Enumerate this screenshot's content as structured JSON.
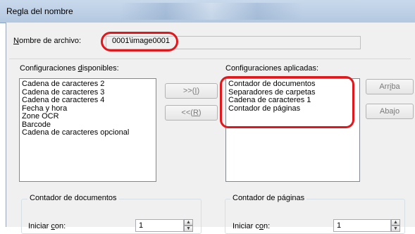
{
  "window": {
    "title": "Regla del nombre"
  },
  "filename": {
    "label_prefix": "N",
    "label_rest": "ombre de archivo:",
    "value": "0001\\image0001"
  },
  "available": {
    "label_prefix": "Configuraciones ",
    "label_u": "d",
    "label_rest": "isponibles:",
    "items": [
      "Cadena de caracteres 2",
      "Cadena de caracteres 3",
      "Cadena de caracteres 4",
      "Fecha y hora",
      "Zone OCR",
      "Barcode",
      "Cadena de caracteres opcional"
    ]
  },
  "applied": {
    "label": "Configuraciones aplicadas:",
    "items": [
      "Contador de documentos",
      "Separadores de carpetas",
      "Cadena de caracteres 1",
      "Contador de páginas"
    ]
  },
  "buttons": {
    "add": {
      "pre": ">>(",
      "u": "I",
      "post": ")"
    },
    "remove": {
      "pre": "<<(",
      "u": "R",
      "post": ")"
    },
    "up": {
      "pre": "Arr",
      "u": "i",
      "post": "ba"
    },
    "down": {
      "label": "Abajo"
    }
  },
  "doc_counter": {
    "title": "Contador de documentos",
    "start_pre": "Iniciar ",
    "start_u": "c",
    "start_post": "on:",
    "start_value": "1"
  },
  "page_counter": {
    "title": "Contador de páginas",
    "start_pre": "Iniciar c",
    "start_u": "o",
    "start_post": "n:",
    "start_value": "1"
  },
  "colors": {
    "highlight": "#e3161b",
    "titlebar": "#c9d9ec"
  },
  "icons": {
    "spin_up": "▲",
    "spin_down": "▼"
  }
}
